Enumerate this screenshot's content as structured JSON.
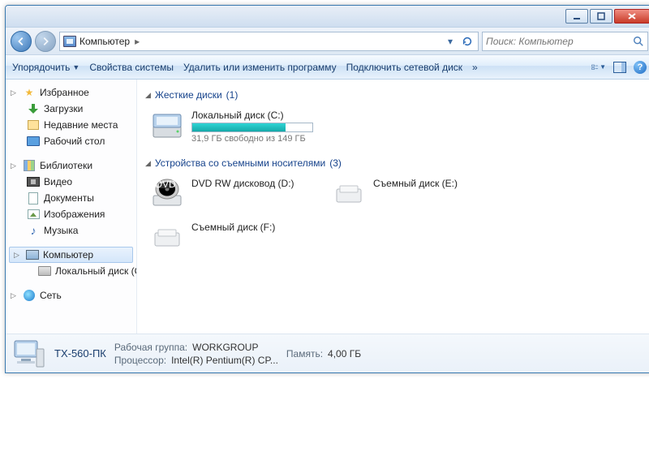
{
  "titlebar": {},
  "nav": {
    "breadcrumb": "Компьютер",
    "search_placeholder": "Поиск: Компьютер"
  },
  "toolbar": {
    "organize": "Упорядочить",
    "properties": "Свойства системы",
    "uninstall": "Удалить или изменить программу",
    "map_drive": "Подключить сетевой диск",
    "more": "»"
  },
  "sidebar": {
    "favorites": {
      "label": "Избранное",
      "items": [
        "Загрузки",
        "Недавние места",
        "Рабочий стол"
      ]
    },
    "libraries": {
      "label": "Библиотеки",
      "items": [
        "Видео",
        "Документы",
        "Изображения",
        "Музыка"
      ]
    },
    "computer": {
      "label": "Компьютер",
      "items": [
        "Локальный диск (C:"
      ]
    },
    "network": {
      "label": "Сеть"
    }
  },
  "groups": {
    "hdd": {
      "title": "Жесткие диски",
      "count": "(1)",
      "items": [
        {
          "name": "Локальный диск (C:)",
          "free": "31,9 ГБ свободно из 149 ГБ",
          "used_pct": 78
        }
      ]
    },
    "removable": {
      "title": "Устройства со съемными носителями",
      "count": "(3)",
      "items": [
        {
          "name": "DVD RW дисковод (D:)"
        },
        {
          "name": "Съемный диск (E:)"
        },
        {
          "name": "Съемный диск (F:)"
        }
      ]
    }
  },
  "details": {
    "name": "ТХ-560-ПК",
    "workgroup_label": "Рабочая группа:",
    "workgroup": "WORKGROUP",
    "cpu_label": "Процессор:",
    "cpu": "Intel(R) Pentium(R) CP...",
    "memory_label": "Память:",
    "memory": "4,00 ГБ"
  }
}
